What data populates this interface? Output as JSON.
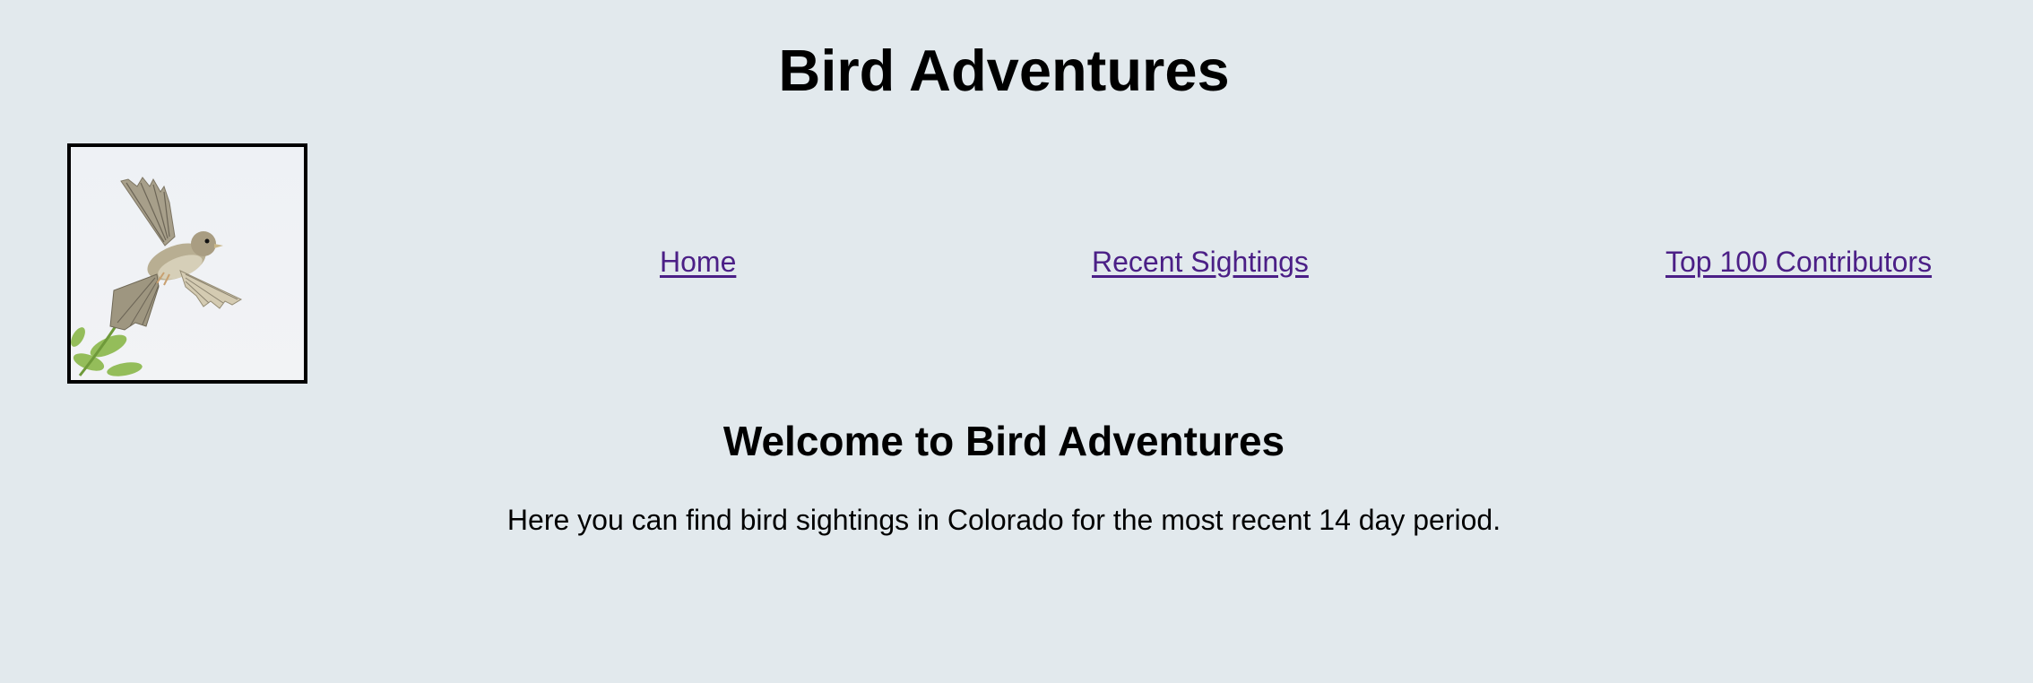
{
  "header": {
    "title": "Bird Adventures"
  },
  "logo": {
    "icon": "sparrow-in-flight-photo"
  },
  "nav": {
    "home": "Home",
    "recent_sightings": "Recent Sightings",
    "top_contributors": "Top 100 Contributors",
    "link_color": "#4b1f86"
  },
  "main": {
    "heading": "Welcome to Bird Adventures",
    "intro": "Here you can find bird sightings in Colorado for the most recent 14 day period."
  },
  "colors": {
    "background": "#e2e9ed",
    "text": "#000000"
  }
}
